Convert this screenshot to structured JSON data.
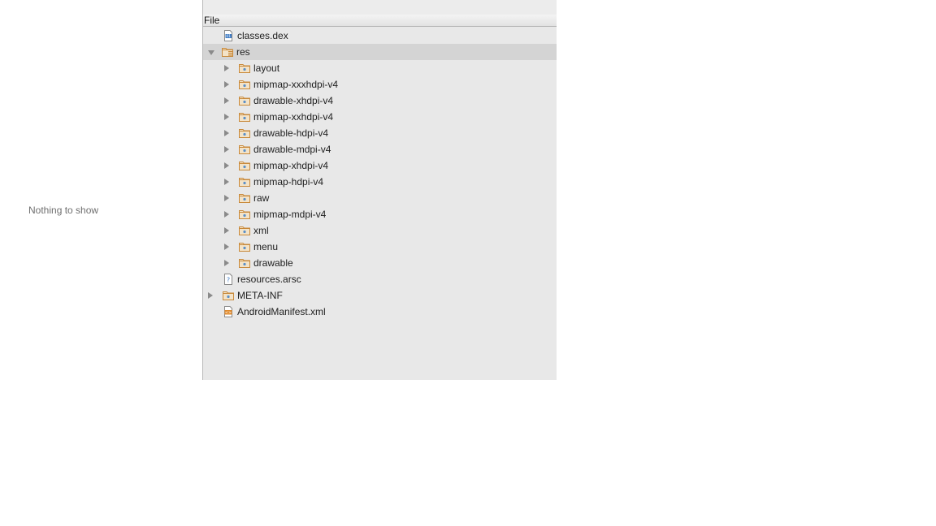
{
  "empty_state": {
    "text": "Nothing to show"
  },
  "panel": {
    "column_header": "File",
    "tree": [
      {
        "label": "classes.dex",
        "icon": "dex-file-icon",
        "type": "dex",
        "depth": 1,
        "toggle": "none"
      },
      {
        "label": "res",
        "icon": "resource-folder-icon",
        "type": "resfolder",
        "depth": 0,
        "toggle": "expanded",
        "selected": true
      },
      {
        "label": "layout",
        "icon": "folder-icon",
        "type": "folder",
        "depth": 2,
        "toggle": "collapsed"
      },
      {
        "label": "mipmap-xxxhdpi-v4",
        "icon": "folder-icon",
        "type": "folder",
        "depth": 2,
        "toggle": "collapsed"
      },
      {
        "label": "drawable-xhdpi-v4",
        "icon": "folder-icon",
        "type": "folder",
        "depth": 2,
        "toggle": "collapsed"
      },
      {
        "label": "mipmap-xxhdpi-v4",
        "icon": "folder-icon",
        "type": "folder",
        "depth": 2,
        "toggle": "collapsed"
      },
      {
        "label": "drawable-hdpi-v4",
        "icon": "folder-icon",
        "type": "folder",
        "depth": 2,
        "toggle": "collapsed"
      },
      {
        "label": "drawable-mdpi-v4",
        "icon": "folder-icon",
        "type": "folder",
        "depth": 2,
        "toggle": "collapsed"
      },
      {
        "label": "mipmap-xhdpi-v4",
        "icon": "folder-icon",
        "type": "folder",
        "depth": 2,
        "toggle": "collapsed"
      },
      {
        "label": "mipmap-hdpi-v4",
        "icon": "folder-icon",
        "type": "folder",
        "depth": 2,
        "toggle": "collapsed"
      },
      {
        "label": "raw",
        "icon": "folder-icon",
        "type": "folder",
        "depth": 2,
        "toggle": "collapsed"
      },
      {
        "label": "mipmap-mdpi-v4",
        "icon": "folder-icon",
        "type": "folder",
        "depth": 2,
        "toggle": "collapsed"
      },
      {
        "label": "xml",
        "icon": "folder-icon",
        "type": "folder",
        "depth": 2,
        "toggle": "collapsed"
      },
      {
        "label": "menu",
        "icon": "folder-icon",
        "type": "folder",
        "depth": 2,
        "toggle": "collapsed"
      },
      {
        "label": "drawable",
        "icon": "folder-icon",
        "type": "folder",
        "depth": 2,
        "toggle": "collapsed"
      },
      {
        "label": "resources.arsc",
        "icon": "unknown-file-icon",
        "type": "unknown",
        "depth": 1,
        "toggle": "none"
      },
      {
        "label": "META-INF",
        "icon": "folder-icon",
        "type": "folder",
        "depth": 1,
        "toggle": "collapsed"
      },
      {
        "label": "AndroidManifest.xml",
        "icon": "xml-file-icon",
        "type": "xml",
        "depth": 1,
        "toggle": "none"
      }
    ]
  },
  "colors": {
    "panel_bg": "#e8e8e8",
    "selected_row": "#d4d4d4",
    "folder_accent": "#c8893a",
    "folder_dot": "#5a8fc8",
    "empty_text": "#6e6e6e"
  }
}
